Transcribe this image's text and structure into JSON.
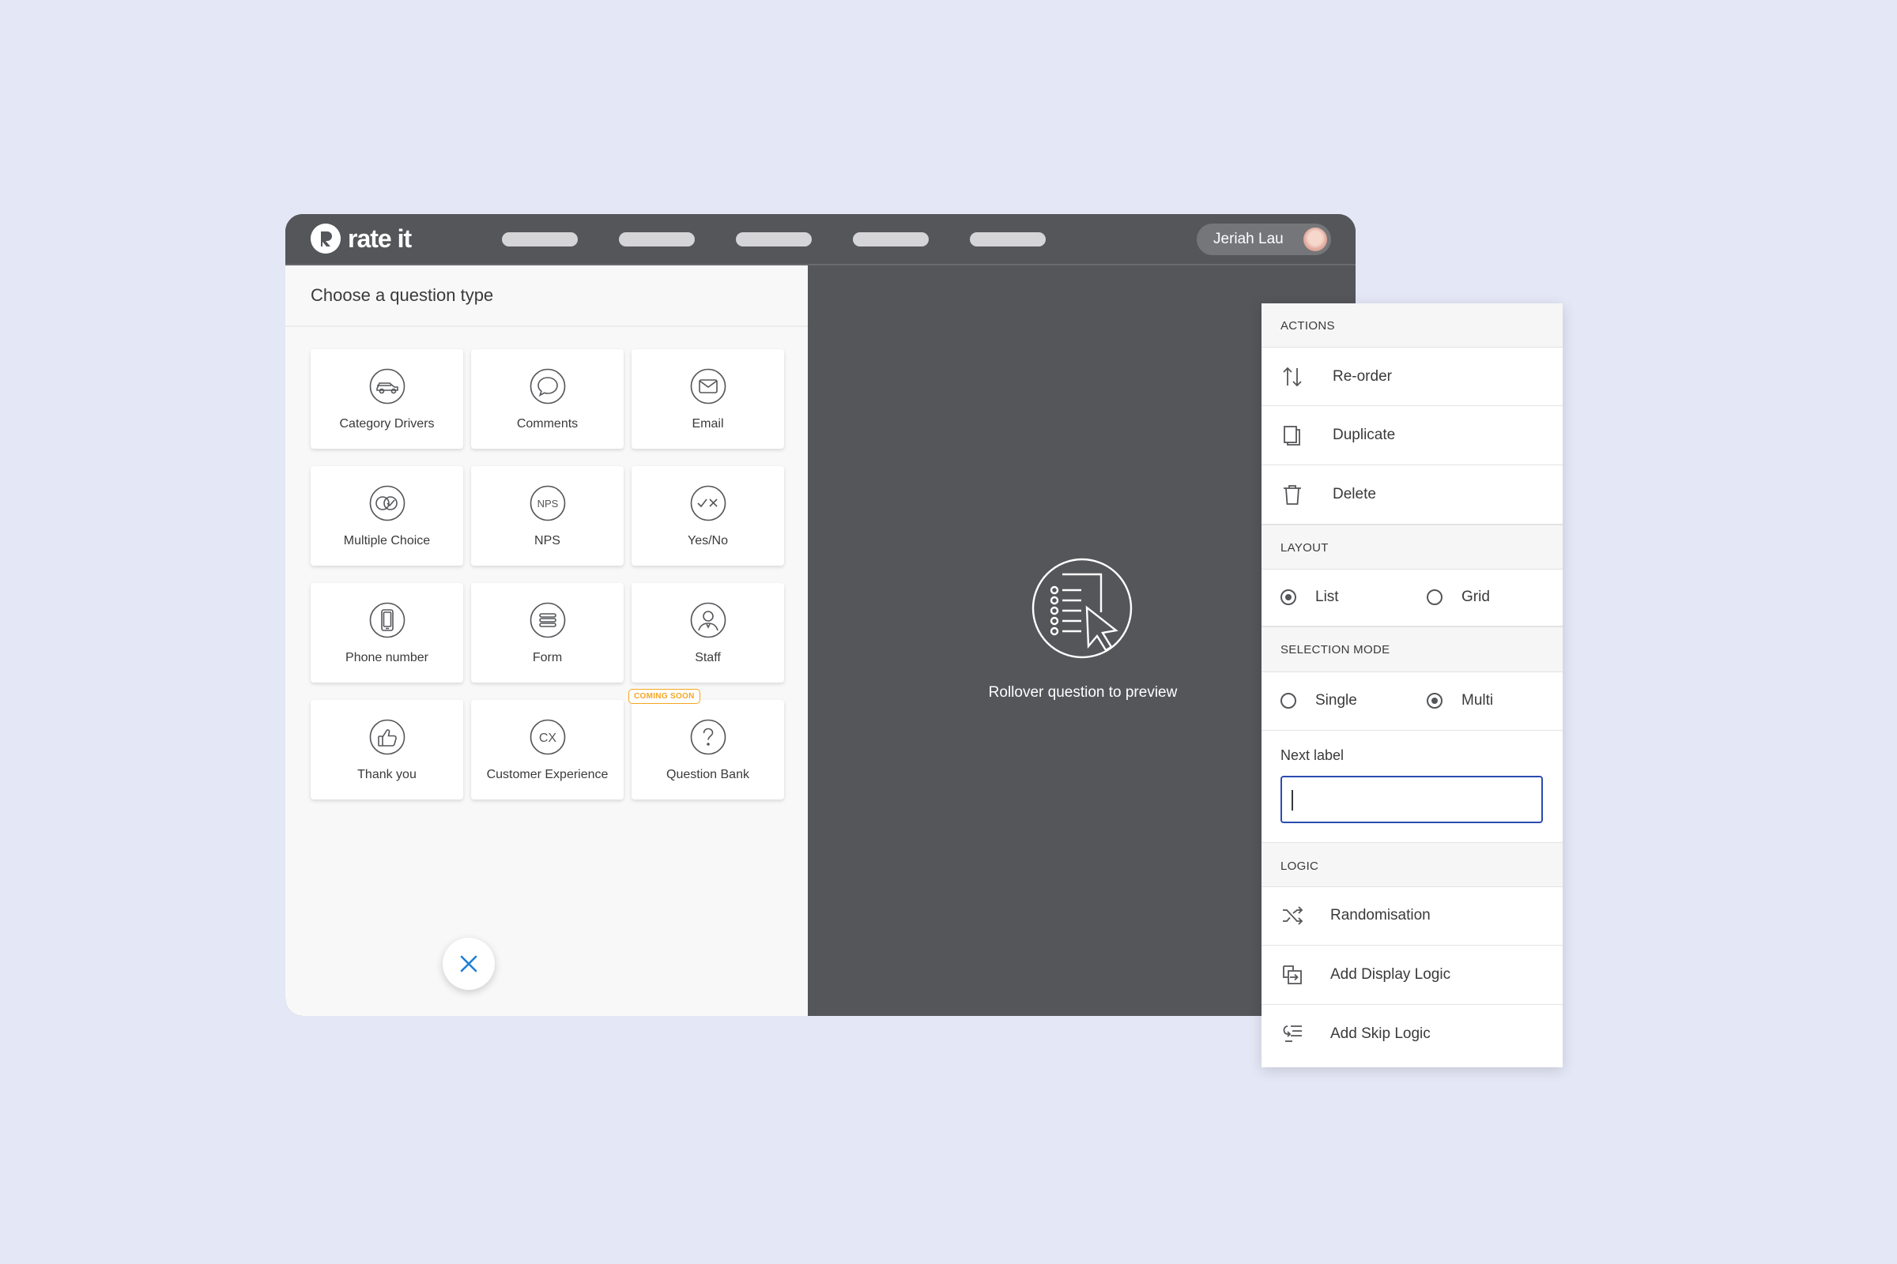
{
  "app": {
    "logo_text": "rate it",
    "nav_items": [
      "",
      "",
      "",
      "",
      ""
    ],
    "user_name": "Jeriah Lau"
  },
  "left": {
    "title": "Choose a question type",
    "cards": [
      {
        "label": "Category Drivers",
        "icon": "car-icon"
      },
      {
        "label": "Comments",
        "icon": "speech-bubble-icon"
      },
      {
        "label": "Email",
        "icon": "envelope-icon"
      },
      {
        "label": "Multiple Choice",
        "icon": "multiple-check-icon"
      },
      {
        "label": "NPS",
        "icon": "nps-icon",
        "icon_text": "NPS"
      },
      {
        "label": "Yes/No",
        "icon": "yes-no-icon"
      },
      {
        "label": "Phone number",
        "icon": "phone-icon"
      },
      {
        "label": "Form",
        "icon": "form-icon"
      },
      {
        "label": "Staff",
        "icon": "staff-icon"
      },
      {
        "label": "Thank you",
        "icon": "thumbs-up-icon"
      },
      {
        "label": "Customer Experience",
        "icon": "cx-icon",
        "icon_text": "CX"
      },
      {
        "label": "Question Bank",
        "icon": "question-mark-icon",
        "badge": "COMING SOON"
      }
    ]
  },
  "preview": {
    "text": "Rollover question to preview",
    "icon": "list-cursor-icon"
  },
  "panel": {
    "actions_title": "ACTIONS",
    "actions": [
      {
        "label": "Re-order",
        "icon": "reorder-arrows-icon"
      },
      {
        "label": "Duplicate",
        "icon": "duplicate-icon"
      },
      {
        "label": "Delete",
        "icon": "trash-icon"
      }
    ],
    "layout_title": "LAYOUT",
    "layout_options": [
      {
        "label": "List",
        "checked": true
      },
      {
        "label": "Grid",
        "checked": false
      }
    ],
    "selection_title": "SELECTION MODE",
    "selection_options": [
      {
        "label": "Single",
        "checked": false
      },
      {
        "label": "Multi",
        "checked": true
      }
    ],
    "next_label": {
      "label": "Next label",
      "value": ""
    },
    "logic_title": "LOGIC",
    "logic": [
      {
        "label": "Randomisation",
        "icon": "shuffle-icon"
      },
      {
        "label": "Add Display Logic",
        "icon": "display-logic-icon"
      },
      {
        "label": "Add Skip Logic",
        "icon": "skip-logic-icon"
      }
    ]
  },
  "colors": {
    "background": "#e4e7f6",
    "app_dark": "#55565a",
    "accent_blue": "#2a4bb0",
    "close_blue": "#1d7fd6",
    "badge_orange": "#f5a623"
  }
}
